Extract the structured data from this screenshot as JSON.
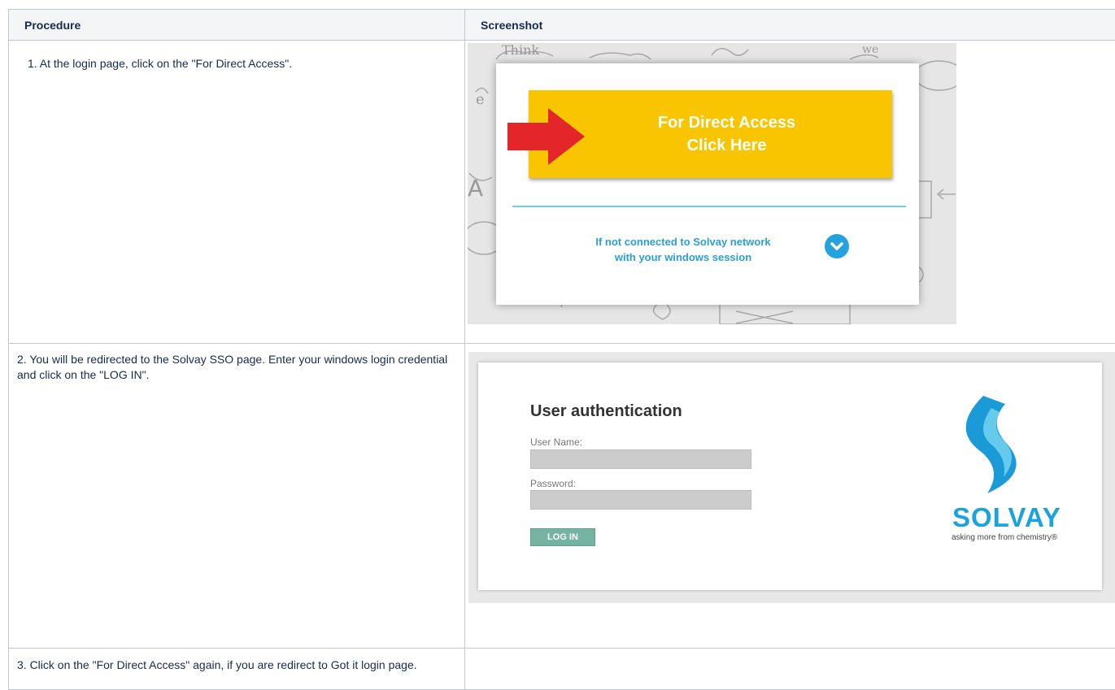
{
  "table": {
    "headers": [
      "Procedure",
      "Screenshot"
    ],
    "steps": [
      "1.  At the login page, click on the \"For Direct Access\".",
      "2. You will be redirected to the Solvay SSO page. Enter your windows login credential and click on the \"LOG IN\".",
      "3. Click on the \"For Direct Access\" again, if you are redirect to Got it login page."
    ]
  },
  "screenshot1": {
    "button_line1": "For Direct Access",
    "button_line2": "Click Here",
    "notice_line1": "If not connected to Solvay network",
    "notice_line2": "with your windows session",
    "icons": [
      "red-arrow-icon",
      "chevron-down-icon"
    ],
    "colors": {
      "button": "#f9c400",
      "arrow": "#e3262a",
      "accent": "#25a3dd"
    }
  },
  "screenshot2": {
    "title": "User authentication",
    "username_label": "User Name:",
    "password_label": "Password:",
    "login_button": "LOG IN",
    "brand": "SOLVAY",
    "tagline": "asking more from chemistry®",
    "colors": {
      "button": "#76b4a2",
      "brand": "#1aa3dd"
    }
  }
}
